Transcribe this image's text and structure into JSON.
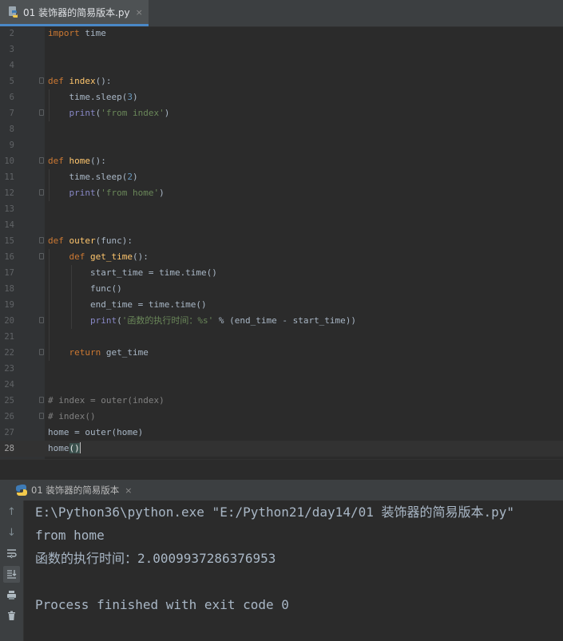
{
  "editor_tab": {
    "label": "01 装饰器的简易版本.py",
    "close": "×",
    "icon": "python-file-icon"
  },
  "code_lines": [
    {
      "n": "2",
      "text": "import time"
    },
    {
      "n": "3",
      "text": ""
    },
    {
      "n": "4",
      "text": ""
    },
    {
      "n": "5",
      "text": "def index():"
    },
    {
      "n": "6",
      "text": "    time.sleep(3)"
    },
    {
      "n": "7",
      "text": "    print('from index')"
    },
    {
      "n": "8",
      "text": ""
    },
    {
      "n": "9",
      "text": ""
    },
    {
      "n": "10",
      "text": "def home():"
    },
    {
      "n": "11",
      "text": "    time.sleep(2)"
    },
    {
      "n": "12",
      "text": "    print('from home')"
    },
    {
      "n": "13",
      "text": ""
    },
    {
      "n": "14",
      "text": ""
    },
    {
      "n": "15",
      "text": "def outer(func):"
    },
    {
      "n": "16",
      "text": "    def get_time():"
    },
    {
      "n": "17",
      "text": "        start_time = time.time()"
    },
    {
      "n": "18",
      "text": "        func()"
    },
    {
      "n": "19",
      "text": "        end_time = time.time()"
    },
    {
      "n": "20",
      "text": "        print('函数的执行时间：%s' % (end_time - start_time))"
    },
    {
      "n": "21",
      "text": ""
    },
    {
      "n": "22",
      "text": "    return get_time"
    },
    {
      "n": "23",
      "text": ""
    },
    {
      "n": "24",
      "text": ""
    },
    {
      "n": "25",
      "text": "# index = outer(index)"
    },
    {
      "n": "26",
      "text": "# index()"
    },
    {
      "n": "27",
      "text": "home = outer(home)"
    },
    {
      "n": "28",
      "text": "home()"
    }
  ],
  "current_line": "28",
  "run_tab": {
    "label": "01 装饰器的简易版本",
    "close": "×",
    "icon": "python-run-icon"
  },
  "run_tools": [
    "up-arrow-icon",
    "down-arrow-icon",
    "soft-wrap-icon",
    "scroll-to-end-icon",
    "print-icon",
    "trash-icon"
  ],
  "console_lines": [
    "E:\\Python36\\python.exe \"E:/Python21/day14/01 装饰器的简易版本.py\"",
    "from home",
    "函数的执行时间：2.0009937286376953",
    "",
    "Process finished with exit code 0"
  ],
  "colors": {
    "keyword": "#cc7832",
    "function": "#ffc66d",
    "number": "#6897bb",
    "string": "#6a8759",
    "comment": "#808080",
    "text": "#a9b7c6",
    "background": "#2b2b2b"
  }
}
